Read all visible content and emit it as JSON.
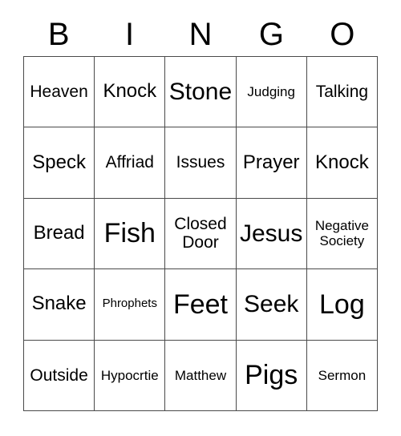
{
  "header": {
    "letters": [
      "B",
      "I",
      "N",
      "G",
      "O"
    ]
  },
  "grid": {
    "columns": 5,
    "rows": 5,
    "border_color": "#4a4a4a",
    "background": "#ffffff",
    "text_color": "#000000",
    "cells": [
      {
        "text": "Heaven",
        "size": "fs-sm"
      },
      {
        "text": "Knock",
        "size": "fs-md"
      },
      {
        "text": "Stone",
        "size": "fs-lg"
      },
      {
        "text": "Judging",
        "size": "fs-xs"
      },
      {
        "text": "Talking",
        "size": "fs-sm"
      },
      {
        "text": "Speck",
        "size": "fs-md"
      },
      {
        "text": "Affriad",
        "size": "fs-sm"
      },
      {
        "text": "Issues",
        "size": "fs-sm"
      },
      {
        "text": "Prayer",
        "size": "fs-md"
      },
      {
        "text": "Knock",
        "size": "fs-md"
      },
      {
        "text": "Bread",
        "size": "fs-md"
      },
      {
        "text": "Fish",
        "size": "fs-xl"
      },
      {
        "text": "Closed Door",
        "size": "fs-sm"
      },
      {
        "text": "Jesus",
        "size": "fs-lg"
      },
      {
        "text": "Negative Society",
        "size": "fs-xs"
      },
      {
        "text": "Snake",
        "size": "fs-md"
      },
      {
        "text": "Phrophets",
        "size": "fs-xxs"
      },
      {
        "text": "Feet",
        "size": "fs-xl"
      },
      {
        "text": "Seek",
        "size": "fs-lg"
      },
      {
        "text": "Log",
        "size": "fs-xl"
      },
      {
        "text": "Outside",
        "size": "fs-sm"
      },
      {
        "text": "Hypocrtie",
        "size": "fs-xs"
      },
      {
        "text": "Matthew",
        "size": "fs-xs"
      },
      {
        "text": "Pigs",
        "size": "fs-xl"
      },
      {
        "text": "Sermon",
        "size": "fs-xs"
      }
    ]
  }
}
